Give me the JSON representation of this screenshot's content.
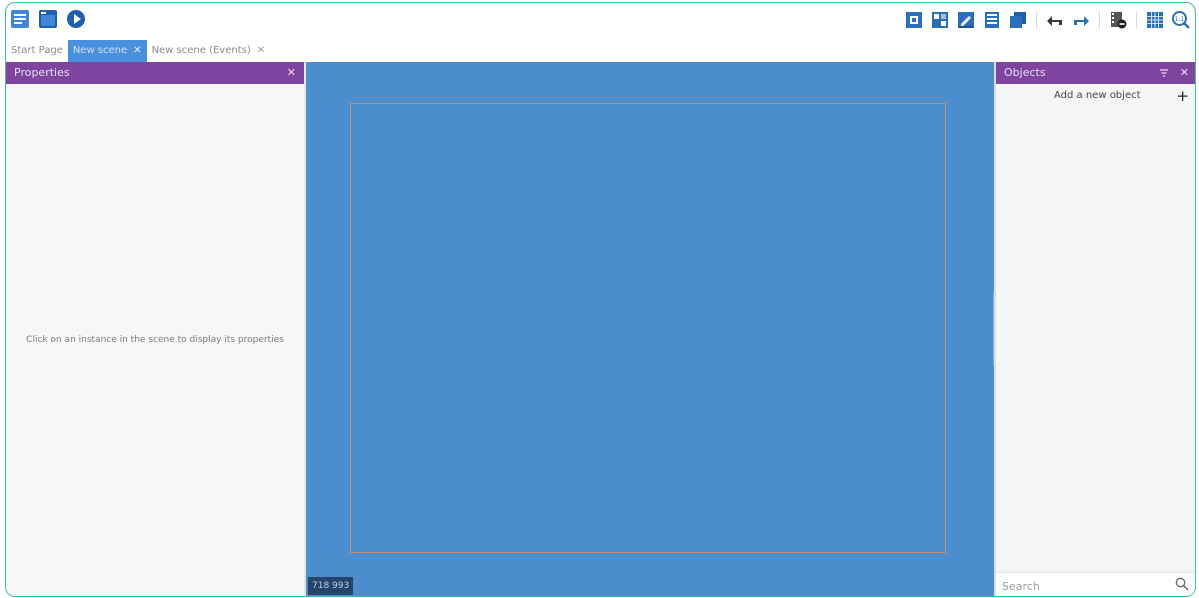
{
  "toolbar": {
    "left_icons": [
      "project-manager-icon",
      "scene-window-icon",
      "preview-play-icon"
    ],
    "right_icons": [
      "object-icon",
      "object-groups-icon",
      "properties-edit-icon",
      "layers-icon",
      "instances-list-icon",
      "undo-icon",
      "redo-icon",
      "film-delete-icon",
      "grid-icon",
      "zoom-reset-icon"
    ]
  },
  "tabs": [
    {
      "label": "Start Page",
      "closable": false,
      "active": false
    },
    {
      "label": "New scene",
      "closable": true,
      "active": true
    },
    {
      "label": "New scene (Events)",
      "closable": true,
      "active": false
    }
  ],
  "properties": {
    "title": "Properties",
    "hint": "Click on an instance in the scene to display its properties"
  },
  "scene": {
    "status": "718 993",
    "background": "#4a8ecd",
    "frame_color": "#c88c6a"
  },
  "objects": {
    "title": "Objects",
    "add_label": "Add a new object",
    "add_symbol": "+",
    "search_placeholder": "Search"
  },
  "colors": {
    "panel_header": "#7e44a0",
    "active_tab": "#4a90e0",
    "app_border": "#3cc39a"
  }
}
